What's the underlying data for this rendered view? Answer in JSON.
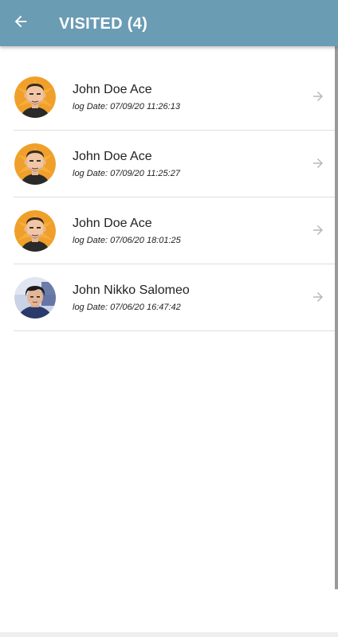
{
  "header": {
    "title": "VISITED (4)",
    "background_color": "#6a9cb4",
    "back_icon": "arrow-left-icon"
  },
  "visits": [
    {
      "name": "John Doe Ace",
      "log_date": "log Date: 07/09/20 11:26:13",
      "avatar": "cartoon-man-avatar",
      "chevron_icon": "arrow-right-icon"
    },
    {
      "name": "John Doe Ace",
      "log_date": "log Date: 07/09/20 11:25:27",
      "avatar": "cartoon-man-avatar",
      "chevron_icon": "arrow-right-icon"
    },
    {
      "name": "John Doe Ace",
      "log_date": "log Date: 07/06/20 18:01:25",
      "avatar": "cartoon-man-avatar",
      "chevron_icon": "arrow-right-icon"
    },
    {
      "name": "John Nikko Salomeo",
      "log_date": "log Date: 07/06/20 16:47:42",
      "avatar": "photo-avatar",
      "chevron_icon": "arrow-right-icon"
    }
  ]
}
